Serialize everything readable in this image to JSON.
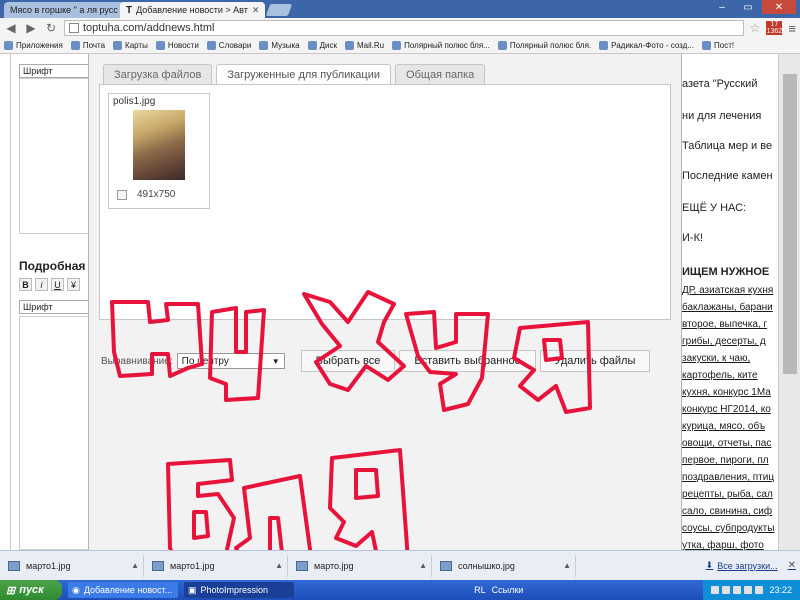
{
  "browser": {
    "tabs": [
      {
        "title": "Мясо в горшке \" а ля русс",
        "active": false
      },
      {
        "title": "Добавление новости > Авт",
        "active": true
      }
    ],
    "url": "toptuha.com/addnews.html",
    "badge_top": "17",
    "badge_bottom": "1362",
    "bookmarks": [
      "Приложения",
      "Почта",
      "Карты",
      "Новости",
      "Словари",
      "Музыка",
      "Диск",
      "Mail.Ru",
      "Полярный полюс бля...",
      "Полярный полюс бля.",
      "Радикал-Фото - созд...",
      "Пост!"
    ]
  },
  "editor": {
    "font_select_top": "Шрифт",
    "heading": "Подробная",
    "format_buttons": [
      "B",
      "i",
      "U",
      "¥"
    ],
    "font_select_bottom": "Шрифт"
  },
  "modal": {
    "tabs": [
      {
        "label": "Загрузка файлов",
        "active": false
      },
      {
        "label": "Загруженные для публикации",
        "active": true
      },
      {
        "label": "Общая папка",
        "active": false
      }
    ],
    "file": {
      "name": "polis1.jpg",
      "dims": "491x750"
    },
    "align_label": "Выравнивание:",
    "align_value": "По центру",
    "buttons": [
      "Выбрать все",
      "Вставить выбранное",
      "Удалить файлы"
    ]
  },
  "sidebar": {
    "lines": [
      "азета \"Русский",
      "ни для лечения",
      "Таблица мер и ве",
      "Последние камен",
      "ЕЩЁ У НАС:",
      "И-К!"
    ],
    "section_heading": "ИЩЕМ НУЖНОЕ",
    "tags": [
      "ДР, азиатская кухня",
      "баклажаны, барани",
      "второе, выпечка, г",
      "грибы, десерты, д",
      "закуски, к чаю,",
      "картофель, ките",
      "кухня, конкурс 1Ма",
      "конкурс НГ2014, ко",
      "курица, мясо, объ",
      "овощи, отчеты, пас",
      "первое, пироги, пл",
      "поздравления, птиц",
      "рецепты, рыба, сал",
      "сало, свинина, сиф",
      "соусы, субпродукты",
      "утка, фарш, фото"
    ]
  },
  "overlay": {
    "scribble_text": [
      "Ну хуя",
      "бля"
    ],
    "color": "#e8133a"
  },
  "downloads": {
    "items": [
      "марто1.jpg",
      "марто1.jpg",
      "марто.jpg",
      "солнышко.jpg"
    ],
    "all_label": "Все загрузки..."
  },
  "taskbar": {
    "start": "пуск",
    "tasks": [
      "Добавление новост...",
      "PhotoImpression"
    ],
    "lang": "RL",
    "links": "Ссылки",
    "time": "23:22"
  }
}
